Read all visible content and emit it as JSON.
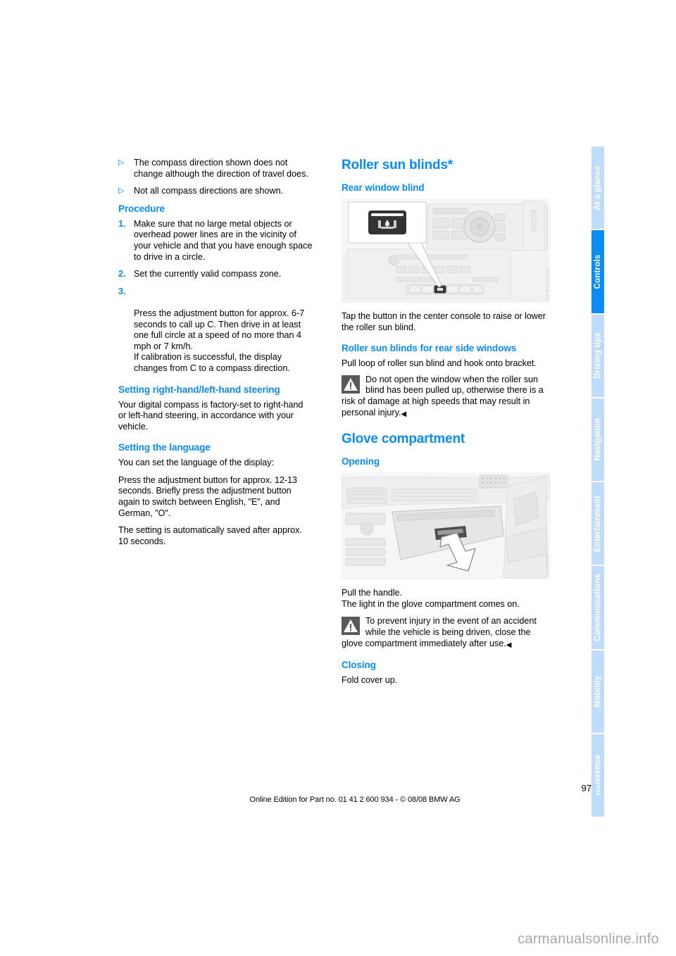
{
  "document": {
    "page_number": "97",
    "edition_line": "Online Edition for Part no. 01 41 2 600 934 - © 08/08 BMW AG",
    "watermark": "carmanualsonline.info"
  },
  "sidebar": {
    "tabs": [
      {
        "label": "At a glance",
        "active": false
      },
      {
        "label": "Controls",
        "active": true
      },
      {
        "label": "Driving tips",
        "active": false
      },
      {
        "label": "Navigation",
        "active": false
      },
      {
        "label": "Entertainment",
        "active": false
      },
      {
        "label": "Communications",
        "active": false
      },
      {
        "label": "Mobility",
        "active": false
      },
      {
        "label": "Reference",
        "active": false
      }
    ]
  },
  "colors": {
    "accent_blue": "#0a8bf5",
    "tab_inactive": "#bfdcfb",
    "warning_icon_bg": "#58595b",
    "figure_bg": "#f4f4f4"
  },
  "left_column": {
    "bullets": [
      {
        "marker": "▷",
        "text": "The compass direction shown does not change although the direction of travel does."
      },
      {
        "marker": "▷",
        "text": "Not all compass directions are shown."
      }
    ],
    "procedure_heading": "Procedure",
    "procedure_steps": [
      {
        "num": "1.",
        "text": "Make sure that no large metal objects or overhead power lines are in the vicinity of your vehicle and that you have enough space to drive in a circle."
      },
      {
        "num": "2.",
        "text": "Set the currently valid compass zone."
      },
      {
        "num": "3.",
        "text": "Press the adjustment button for approx. 6-7 seconds to call up C. Then drive in at least one full circle at a speed of no more than 4 mph or 7 km/h.\nIf calibration is successful, the display changes from C to a compass direction."
      }
    ],
    "steering_heading": "Setting right-hand/left-hand steering",
    "steering_para": "Your digital compass is factory-set to right-hand or left-hand steering, in accordance with your vehicle.",
    "language_heading": "Setting the language",
    "language_para_1": "You can set the language of the display:",
    "language_para_2": "Press the adjustment button for approx. 12-13 seconds. Briefly press the adjustment button again to switch between English, \"E\", and German, \"O\".",
    "language_para_3": "The setting is automatically saved after approx. 10 seconds."
  },
  "right_column": {
    "roller_title": "Roller sun blinds*",
    "rear_window_heading": "Rear window blind",
    "figure_console": {
      "name": "center-console-roller-blind-button",
      "code": "WPC93014150"
    },
    "rear_window_para": "Tap the button in the center console to raise or lower the roller sun blind.",
    "rear_side_heading": "Roller sun blinds for rear side windows",
    "rear_side_para": "Pull loop of roller sun blind and hook onto bracket.",
    "warning_1": "Do not open the window when the roller sun blind has been pulled up, otherwise there is a risk of damage at high speeds that may result in personal injury.",
    "warning_1_endmark": "◀",
    "glove_title": "Glove compartment",
    "opening_heading": "Opening",
    "figure_glove": {
      "name": "glove-compartment-open",
      "code": "MOBB974"
    },
    "glove_para_1": "Pull the handle.",
    "glove_para_2": "The light in the glove compartment comes on.",
    "warning_2": "To prevent injury in the event of an accident while the vehicle is being driven, close the glove compartment immediately after use.",
    "warning_2_endmark": "◀",
    "closing_heading": "Closing",
    "closing_para": "Fold cover up."
  }
}
